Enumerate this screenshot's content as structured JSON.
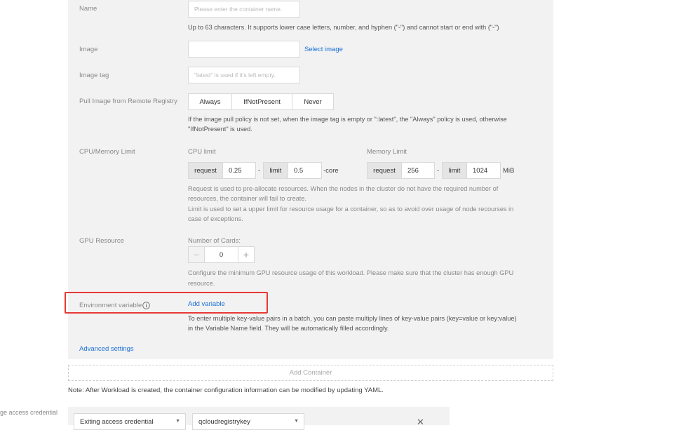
{
  "form": {
    "name": {
      "label": "Name",
      "placeholder": "Please enter the container name.",
      "help": "Up to 63 characters. It supports lower case letters, number, and hyphen (\"-\") and cannot start or end with (\"-\")"
    },
    "image": {
      "label": "Image",
      "value": "",
      "link": "Select image"
    },
    "image_tag": {
      "label": "Image tag",
      "placeholder": "\"latest\" is used if it's left empty."
    },
    "pull": {
      "label": "Pull Image from Remote Registry",
      "options": [
        "Always",
        "IfNotPresent",
        "Never"
      ],
      "help1": "If the image pull policy is not set, when the image tag is empty or \":latest\", the \"Always\" policy is used, otherwise",
      "help2": "\"IfNotPresent\" is used."
    },
    "cpu_mem": {
      "label": "CPU/Memory Limit",
      "cpu_title": "CPU limit",
      "mem_title": "Memory Limit",
      "request_label": "request",
      "limit_label": "limit",
      "cpu_request": "0.25",
      "cpu_limit": "0.5",
      "cpu_unit": "-core",
      "mem_request": "256",
      "mem_limit": "1024",
      "mem_unit": "MiB",
      "dash": "-",
      "help1": "Request is used to pre-allocate resources. When the nodes in the cluster do not have the required number of",
      "help2": "resources, the container will fail to create.",
      "help3": "Limit is used to set a upper limit for resource usage for a container, so as to avoid over usage of node recourses in",
      "help4": "case of exceptions."
    },
    "gpu": {
      "label": "GPU Resource",
      "cards_label": "Number of Cards:",
      "minus": "−",
      "plus": "+",
      "value": "0",
      "help1": "Configure the minimum GPU resource usage of this workload. Please make sure that the cluster has enough GPU",
      "help2": "resource."
    },
    "env": {
      "label": "Environment variable",
      "link": "Add variable",
      "help1": "To enter multiple key-value pairs in a batch, you can paste multiply lines of key-value pairs (key=value or key:value)",
      "help2": "in the Variable Name field. They will be automatically filled accordingly."
    },
    "advanced": "Advanced settings"
  },
  "add_container": "Add Container",
  "note": "Note: After Workload is created, the container configuration information can be modified by updating YAML.",
  "credential": {
    "label": "ge access credential",
    "type_value": "Exiting access credential",
    "key_value": "qcloudregistrykey",
    "close": "✕"
  },
  "colors": {
    "accent": "#1a6fd6",
    "highlight": "#e53935",
    "panel": "#f2f2f2"
  }
}
